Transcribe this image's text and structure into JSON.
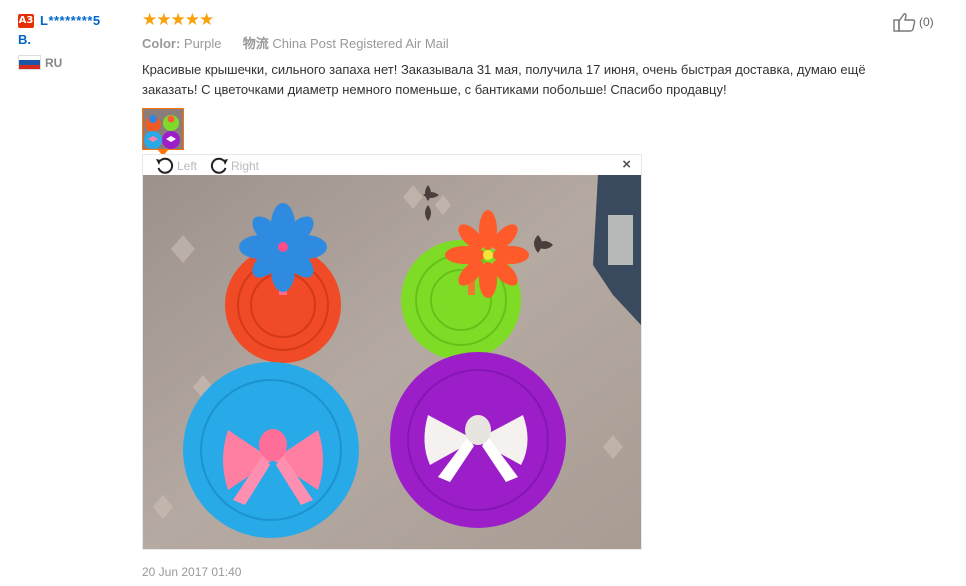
{
  "user": {
    "level": "A3",
    "name_line1": "L********5",
    "name_line2": "B.",
    "country": "RU"
  },
  "review": {
    "rating": 5,
    "stars_text": "★★★★★",
    "color_label": "Color:",
    "color_value": "Purple",
    "shipping_label": "物流",
    "shipping_value": "China Post Registered Air Mail",
    "text": "Красивые крышечки, сильного запаха нет! Заказывала 31 мая, получила 17 июня, очень быстрая доставка, думаю ещё заказать! С цветочками диаметр немного поменьше, с бантиками побольше! Спасибо продавцу!",
    "date": "20 Jun 2017 01:40"
  },
  "viewer": {
    "rotate_left_label": "Left",
    "rotate_right_label": "Right",
    "close_label": "×"
  },
  "helpful": {
    "count_text": "(0)"
  },
  "colors": {
    "star": "#f7a10b",
    "username": "#0066cc",
    "badge": "#e62e04",
    "thumb_border": "#ff7300"
  }
}
